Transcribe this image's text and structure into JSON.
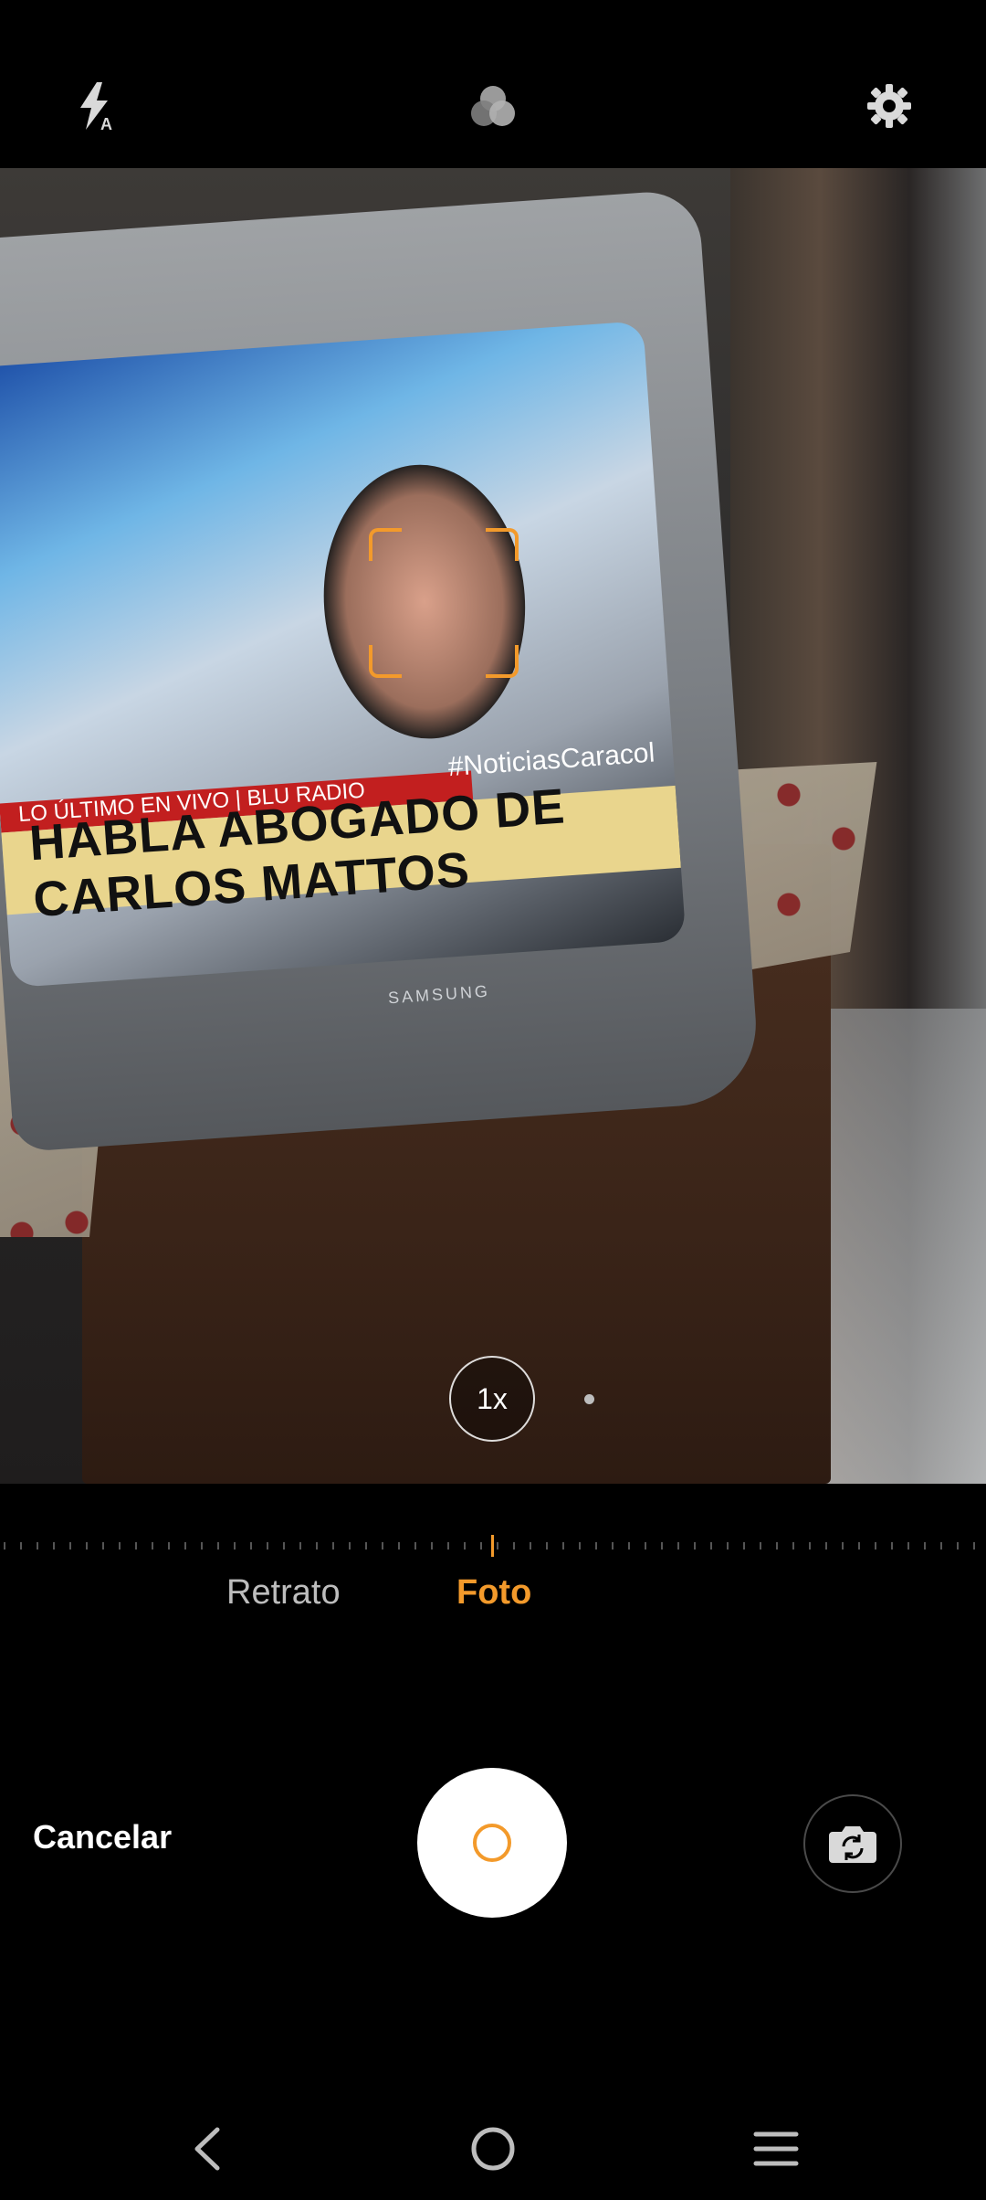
{
  "top_bar": {
    "flash_icon": "flash-auto-icon",
    "filters_icon": "filters-icon",
    "settings_icon": "settings-gear-icon"
  },
  "viewfinder": {
    "tv_banner_text": "HABLA ABOGADO DE CARLOS MATTOS",
    "tv_ticker_text": "LO ÚLTIMO EN VIVO | BLU RADIO",
    "tv_tag_text": "#NoticiasCaracol",
    "tv_brand_text": "SAMSUNG",
    "zoom_label": "1x"
  },
  "modes": [
    {
      "label": "Retrato",
      "active": false
    },
    {
      "label": "Foto",
      "active": true
    }
  ],
  "controls": {
    "cancel_label": "Cancelar",
    "shutter_icon": "shutter-icon",
    "switch_camera_icon": "switch-camera-icon"
  },
  "navbar": {
    "back_icon": "back-icon",
    "home_icon": "home-icon",
    "menu_icon": "menu-icon"
  },
  "colors": {
    "accent": "#f39a2b",
    "background": "#000000",
    "inactive_text": "#bdbdbd"
  }
}
